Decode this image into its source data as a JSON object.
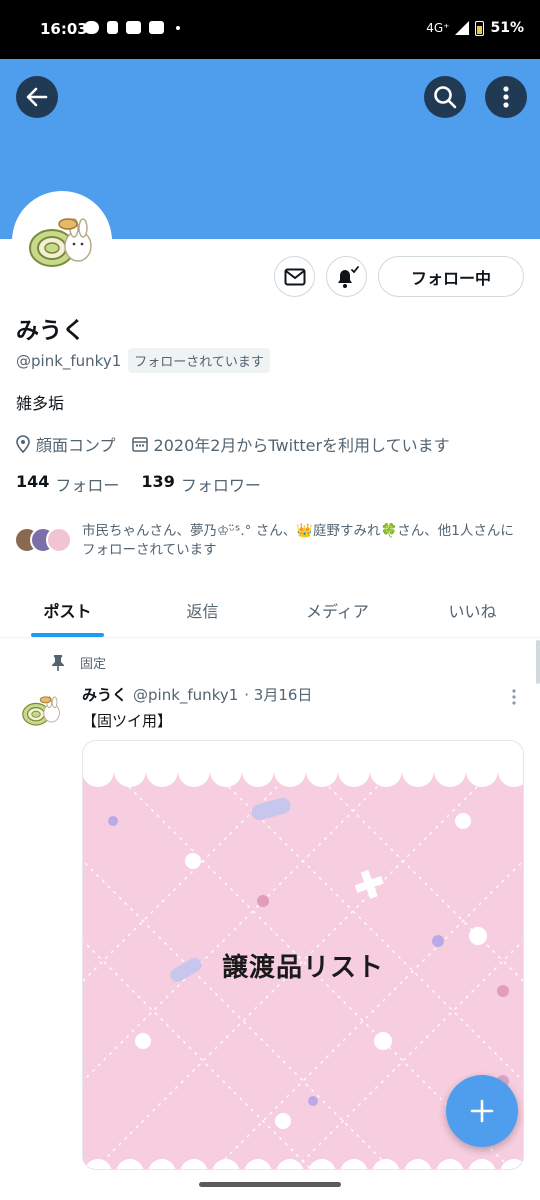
{
  "status_bar": {
    "time": "16:03",
    "network": "4G⁺",
    "battery": "51%"
  },
  "header": {
    "back_icon": "arrow-left-icon",
    "search_icon": "search-icon",
    "more_icon": "more-vertical-icon",
    "banner_color": "#4f9ded"
  },
  "profile": {
    "name": "みうく",
    "handle": "@pink_funky1",
    "follows_you": "フォローされています",
    "bio": "雑多垢",
    "location": "顔面コンプ",
    "joined": "2020年2月からTwitterを利用しています",
    "following_count": "144",
    "following_label": "フォロー",
    "followers_count": "139",
    "followers_label": "フォロワー",
    "followed_by": "市民ちゃんさん、夢乃♔ᵕ̈ᔆ.° さん、👑庭野すみれ🍀さん、他1人さんにフォローされています",
    "follow_button": "フォロー中"
  },
  "tabs": [
    "ポスト",
    "返信",
    "メディア",
    "いいね"
  ],
  "active_tab": 0,
  "tweet": {
    "pinned_label": "固定",
    "name": "みうく",
    "handle": "@pink_funky1",
    "time": "· 3月16日",
    "text": "【固ツイ用】",
    "media_title": "譲渡品リスト"
  },
  "fab_label": "+",
  "accent": "#1d9bf0"
}
